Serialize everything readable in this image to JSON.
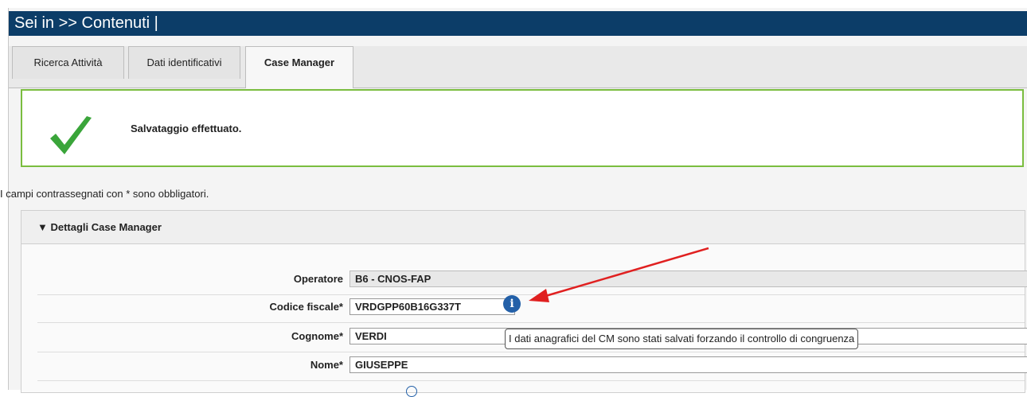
{
  "header": {
    "title": "Sei in >> Contenuti |"
  },
  "tabs": [
    {
      "label": "Ricerca Attività",
      "active": false
    },
    {
      "label": "Dati identificativi",
      "active": false
    },
    {
      "label": "Case Manager",
      "active": true
    }
  ],
  "alert": {
    "message": "Salvataggio effettuato.",
    "icon": "check-icon",
    "color": "#7abd3f"
  },
  "required_note": "I campi contrassegnati con * sono obbligatori.",
  "panel": {
    "title": "Dettagli Case Manager",
    "fields": {
      "operatore": {
        "label": "Operatore",
        "value": "B6 - CNOS-FAP"
      },
      "codice_fiscale": {
        "label": "Codice fiscale*",
        "value": "VRDGPP60B16G337T"
      },
      "cognome": {
        "label": "Cognome*",
        "value": "VERDI"
      },
      "nome": {
        "label": "Nome*",
        "value": "GIUSEPPE"
      }
    },
    "info_icon": "i"
  },
  "tooltip": {
    "text": "I dati anagrafici del CM sono stati salvati forzando il controllo di congruenza"
  },
  "colors": {
    "header_bg": "#0c3d68",
    "success": "#7abd3f",
    "info": "#2360a8",
    "annotation_arrow": "#e02020"
  }
}
